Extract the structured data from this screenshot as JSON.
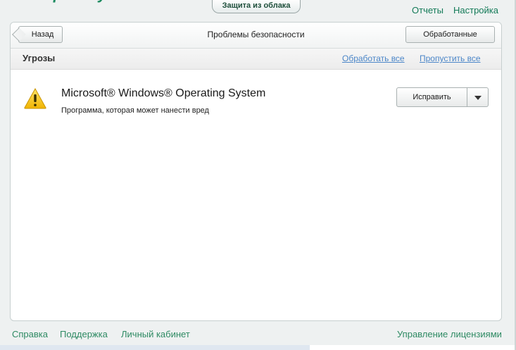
{
  "header_top": {
    "logo_text_green": "kaspersky",
    "logo_text_red": "",
    "cloud_button": "Защита из облака",
    "reports_link": "Отчеты",
    "settings_link": "Настройка"
  },
  "panel": {
    "back_button": "Назад",
    "title": "Проблемы безопасности",
    "processed_button": "Обработанные",
    "section": {
      "title": "Угрозы",
      "process_all": "Обработать все",
      "skip_all": "Пропустить все"
    },
    "threat": {
      "icon": "warning-triangle-icon",
      "name": "Microsoft® Windows® Operating System",
      "description": "Программа, которая может нанести вред",
      "fix_button": "Исправить"
    }
  },
  "footer": {
    "help": "Справка",
    "support": "Поддержка",
    "account": "Личный кабинет",
    "licenses": "Управление лицензиями"
  },
  "colors": {
    "accent_green": "#127a57",
    "link_blue": "#4b86c8",
    "warning_yellow": "#f2c21b"
  }
}
